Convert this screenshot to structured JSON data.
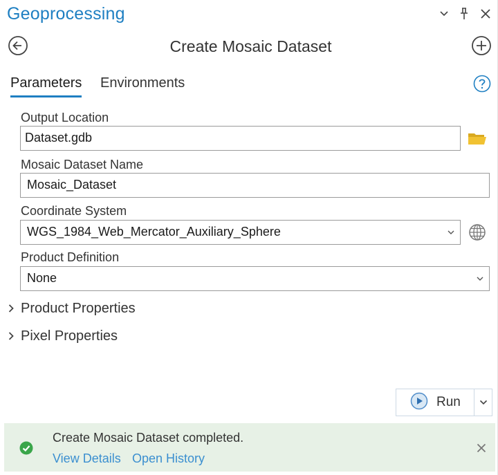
{
  "pane": {
    "title": "Geoprocessing",
    "accent_color": "#1e7fc2",
    "controls": [
      "chevron-down-icon",
      "pin-icon",
      "close-icon"
    ]
  },
  "tool": {
    "title": "Create Mosaic Dataset",
    "back_icon": "back-arrow-icon",
    "add_icon": "add-circle-icon"
  },
  "tabs": [
    {
      "label": "Parameters",
      "active": true
    },
    {
      "label": "Environments",
      "active": false
    }
  ],
  "help_icon": "help-icon",
  "params": {
    "output_location": {
      "label": "Output Location",
      "value": "Dataset.gdb",
      "icon": "folder-open-icon"
    },
    "mosaic_name": {
      "label": "Mosaic Dataset Name",
      "value": "Mosaic_Dataset"
    },
    "coordinate_system": {
      "label": "Coordinate System",
      "value": "WGS_1984_Web_Mercator_Auxiliary_Sphere",
      "icon": "globe-icon"
    },
    "product_definition": {
      "label": "Product Definition",
      "value": "None"
    }
  },
  "expanders": [
    {
      "label": "Product Properties",
      "expanded": false
    },
    {
      "label": "Pixel Properties",
      "expanded": false
    }
  ],
  "run": {
    "label": "Run",
    "icon": "play-icon"
  },
  "status": {
    "message": "Create Mosaic Dataset completed.",
    "view_details": "View Details",
    "open_history": "Open History",
    "success_color": "#3aa64a",
    "background": "#e7f1e6"
  }
}
